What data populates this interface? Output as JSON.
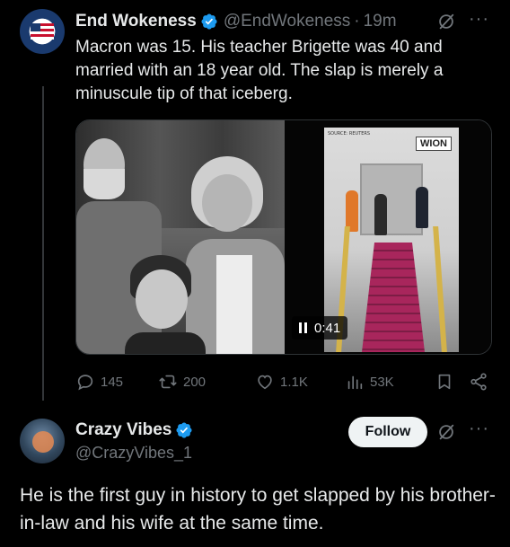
{
  "tweet": {
    "author_name": "End Wokeness",
    "author_handle": "@EndWokeness",
    "time_separator": "·",
    "timestamp": "19m",
    "text": "Macron was 15. His teacher Brigette was 40 and married with an 18 year old. The slap is merely a minuscule tip of that iceberg.",
    "more_label": "···",
    "media": {
      "video_source_label": "SOURCE: REUTERS",
      "video_channel": "WION",
      "video_time": "0:41"
    },
    "actions": {
      "replies": "145",
      "reposts": "200",
      "likes": "1.1K",
      "views": "53K"
    }
  },
  "reply": {
    "author_name": "Crazy Vibes",
    "author_handle": "@CrazyVibes_1",
    "follow_label": "Follow",
    "more_label": "···",
    "text": "He is the first guy in history to get slapped by his brother-in-law and his wife at the same time."
  },
  "colors": {
    "background": "#000000",
    "text": "#e7e9ea",
    "muted": "#71767b",
    "verified": "#1d9bf0"
  }
}
